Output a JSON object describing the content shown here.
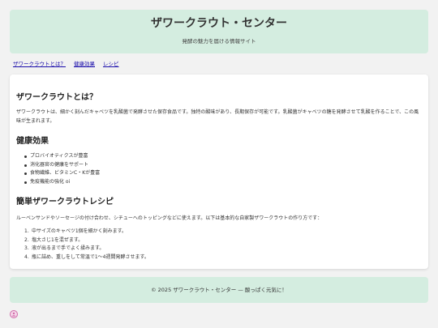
{
  "header": {
    "title": "ザワークラウト・センター",
    "subtitle": "発酵の魅力を届ける情報サイト"
  },
  "nav": {
    "links": [
      "ザワークラウトとは？",
      "健康効果",
      "レシピ"
    ]
  },
  "about": {
    "heading": "ザワークラウトとは？",
    "text": "ザワークラウトは、細かく刻んだキャベツを乳酸菌で発酵させた保存食品です。独特の酸味があり、長期保存が可能です。乳酸菌がキャベツの糖を発酵させて乳酸を作ることで、この風味が生まれます。"
  },
  "health": {
    "heading": "健康効果",
    "items": [
      "プロバイオティクスが豊富",
      "消化器官の健康をサポート",
      "食物繊維、ビタミンC・Kが豊富",
      "免疫機能の強化 oi"
    ]
  },
  "recipe": {
    "heading": "簡単ザワークラウトレシピ",
    "intro": "ルーベンサンドやソーセージの付け合わせ、シチューへのトッピングなどに使えます。以下は基本的な自家製ザワークラウトの作り方です：",
    "steps": [
      "中サイズのキャベツ1個を細かく刻みます。",
      "塩大さじ1を混ぜます。",
      "液が出るまで手でよく揉みます。",
      "瓶に詰め、重しをして常温で1〜4週間発酵させます。"
    ]
  },
  "footer": {
    "text": "© 2025 ザワークラウト・センター — 酸っぱく元気に！"
  },
  "colors": {
    "header_bg": "#d4ede0",
    "link": "#1a0dab",
    "page_bg": "#f2f2f2"
  },
  "icons": {
    "badge": "avatar-icon"
  }
}
